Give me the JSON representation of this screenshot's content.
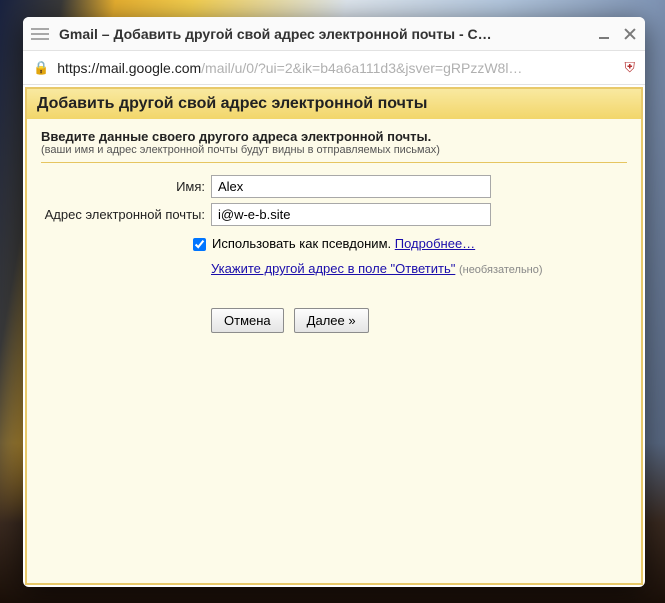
{
  "window": {
    "title": "Gmail  – Добавить другой свой адрес электронной почты - С…"
  },
  "url": {
    "host": "https://mail.google.com",
    "path": "/mail/u/0/?ui=2&ik=b4a6a111d3&jsver=gRPzzW8l…"
  },
  "page": {
    "heading": "Добавить другой свой адрес электронной почты",
    "instr_main": "Введите данные своего другого адреса электронной почты.",
    "instr_sub": "(ваши имя и адрес электронной почты будут видны в отправляемых письмах)"
  },
  "form": {
    "name_label": "Имя:",
    "name_value": "Alex",
    "email_label": "Адрес электронной почты:",
    "email_value": "i@w-e-b.site",
    "alias_text": "Использовать как псевдоним.",
    "alias_link": "Подробнее…",
    "reply_link": "Укажите другой адрес в поле \"Ответить\"",
    "reply_optional": "(необязательно)"
  },
  "buttons": {
    "cancel": "Отмена",
    "next": "Далее »"
  }
}
